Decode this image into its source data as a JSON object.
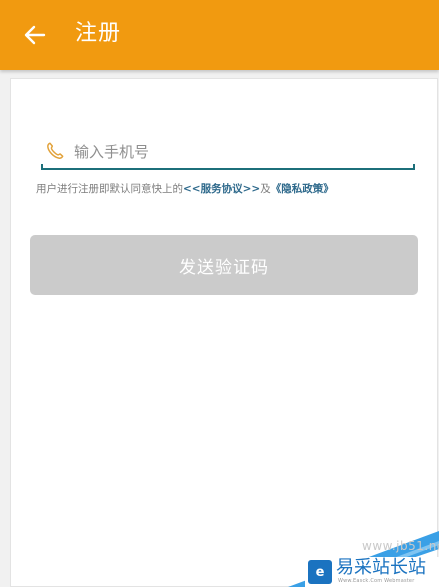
{
  "header": {
    "title": "注册",
    "back_icon": "arrow-left-icon",
    "background_color": "#f19a10"
  },
  "form": {
    "phone_icon": "phone-icon",
    "phone_value": "",
    "phone_placeholder": "输入手机号",
    "agreement_prefix": "用户进行注册即默认同意快上的",
    "service_link": "<<服务协议>>",
    "agreement_join": "及",
    "privacy_link": "《隐私政策》",
    "send_button_label": "发送验证码",
    "send_button_color": "#cbcbcb",
    "accent_color": "#1c6f7a"
  },
  "watermark": {
    "url": "www.jb51.net",
    "logo_glyph": "e",
    "name": "易采站长站",
    "sub": "Www.Easck.Com Webmaster"
  }
}
